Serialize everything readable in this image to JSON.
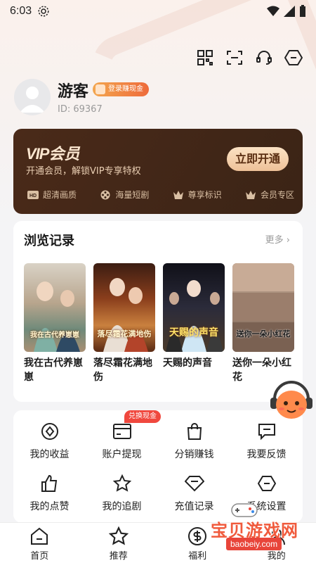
{
  "status_bar": {
    "time": "6:03"
  },
  "profile": {
    "username": "游客",
    "login_badge": "登录赚现金",
    "user_id": "ID: 69367"
  },
  "vip": {
    "title_prefix": "VIP",
    "title": "会员",
    "description": "开通会员，解锁VIP专享特权",
    "button": "立即开通",
    "features": [
      {
        "icon": "hd-icon",
        "label": "超清画质"
      },
      {
        "icon": "film-reel-icon",
        "label": "海量短剧"
      },
      {
        "icon": "crown-icon",
        "label": "尊享标识"
      },
      {
        "icon": "crown-icon",
        "label": "会员专区"
      }
    ]
  },
  "history": {
    "title": "浏览记录",
    "more": "更多 ›",
    "items": [
      {
        "title": "我在古代养崽崽",
        "poster_text": "我在古代养崽崽"
      },
      {
        "title": "落尽霜花满地伤",
        "poster_text": "落尽霜花满地伤"
      },
      {
        "title": "天赐的声音",
        "poster_text": "天赐的声音"
      },
      {
        "title": "送你一朵小红花",
        "poster_text": "送你一朵小红花"
      }
    ]
  },
  "tools": {
    "cash_badge": "兑换现金",
    "items": [
      {
        "icon": "earnings-icon",
        "label": "我的收益"
      },
      {
        "icon": "wallet-card-icon",
        "label": "账户提现"
      },
      {
        "icon": "shopping-bag-icon",
        "label": "分销赚钱"
      },
      {
        "icon": "feedback-icon",
        "label": "我要反馈"
      },
      {
        "icon": "thumbs-up-icon",
        "label": "我的点赞"
      },
      {
        "icon": "star-icon",
        "label": "我的追剧"
      },
      {
        "icon": "diamond-icon",
        "label": "充值记录"
      },
      {
        "icon": "settings-icon",
        "label": "系统设置"
      }
    ]
  },
  "tab_bar": {
    "items": [
      {
        "icon": "home-icon",
        "label": "首页"
      },
      {
        "icon": "star-icon",
        "label": "推荐"
      },
      {
        "icon": "dollar-icon",
        "label": "福利"
      },
      {
        "icon": "person-icon",
        "label": "我的"
      }
    ]
  },
  "watermark": {
    "title": "宝贝游戏网",
    "url": "baobeiy.com"
  },
  "colors": {
    "accent": "#ee6b3b",
    "vip_bg": "#4a2a19",
    "vip_gold": "#fbe2c4",
    "badge_red": "#f0483e"
  }
}
